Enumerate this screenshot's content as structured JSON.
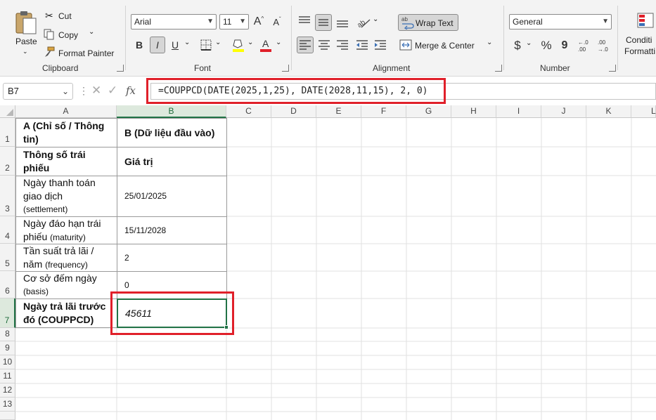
{
  "ribbon": {
    "clipboard": {
      "paste": "Paste",
      "cut": "Cut",
      "copy": "Copy",
      "format_painter": "Format Painter",
      "label": "Clipboard"
    },
    "font": {
      "font_name": "Arial",
      "font_size": "11",
      "bold": "B",
      "italic": "I",
      "underline": "U",
      "grow": "A",
      "shrink": "A",
      "label": "Font"
    },
    "alignment": {
      "wrap_text": "Wrap Text",
      "merge_center": "Merge & Center",
      "label": "Alignment"
    },
    "number": {
      "format": "General",
      "currency": "$",
      "percent": "%",
      "comma": "9",
      "label": "Number"
    },
    "styles": {
      "conditional_line1": "Conditi",
      "conditional_line2": "Formatti"
    }
  },
  "formula_bar": {
    "name_box": "B7",
    "fx": "fx",
    "formula": "=COUPPCD(DATE(2025,1,25), DATE(2028,11,15), 2, 0)"
  },
  "columns": [
    "A",
    "B",
    "C",
    "D",
    "E",
    "F",
    "G",
    "H",
    "I",
    "J",
    "K",
    "L"
  ],
  "rows": [
    "1",
    "2",
    "3",
    "4",
    "5",
    "6",
    "7",
    "8",
    "9",
    "10",
    "11",
    "12",
    "13"
  ],
  "table": {
    "a1_line1": "A (Chỉ số / Thông",
    "a1_line2": "tin)",
    "b1": "B (Dữ liệu đầu vào)",
    "a2_line1": "Thông số trái",
    "a2_line2": "phiếu",
    "b2": "Giá trị",
    "a3_line1": "Ngày thanh toán",
    "a3_line2": "giao dịch",
    "a3_line3": "(settlement)",
    "b3": "25/01/2025",
    "a4_line1": "Ngày đáo hạn trái",
    "a4_line2": "phiếu ",
    "a4_line2_small": "(maturity)",
    "b4": "15/11/2028",
    "a5_line1": "Tần suất trả lãi /",
    "a5_line2": "năm ",
    "a5_line2_small": "(frequency)",
    "b5": "2",
    "a6_line1": "Cơ sở đếm ngày",
    "a6_line2": "(basis)",
    "b6": "0",
    "a7_line1": "Ngày trả lãi trước",
    "a7_line2": "đó (COUPPCD)",
    "b7": "45611"
  },
  "colors": {
    "highlight_red": "#e0202a",
    "selection_green": "#217346",
    "font_color_bar": "#e0202a",
    "fill_color_bar": "#ffff00"
  },
  "icons": [
    "clipboard-icon",
    "scissors-icon",
    "copy-icon",
    "paintbrush-icon",
    "borders-icon",
    "fill-color-icon",
    "font-color-icon",
    "align-icon",
    "orientation-icon",
    "wrap-icon",
    "merge-icon",
    "indent-icon",
    "decimal-icon",
    "conditional-format-icon",
    "cancel-icon",
    "enter-icon"
  ]
}
